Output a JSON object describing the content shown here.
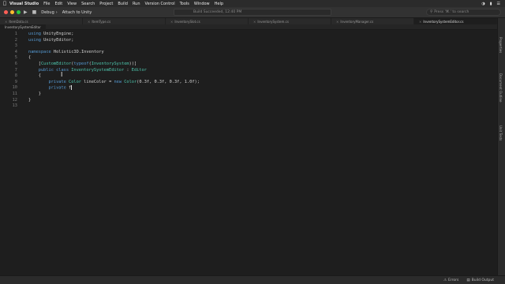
{
  "menubar": {
    "app": "Visual Studio",
    "items": [
      "File",
      "Edit",
      "View",
      "Search",
      "Project",
      "Build",
      "Run",
      "Version Control",
      "Tools",
      "Window",
      "Help"
    ]
  },
  "toolbar": {
    "config": "Debug",
    "target": "Attach to Unity",
    "status": "Build Succeeded, 12:40 PM",
    "search_placeholder": "Press '⌘.' to search"
  },
  "tabs": [
    {
      "label": "ItemData.cs",
      "active": false
    },
    {
      "label": "ItemType.cs",
      "active": false
    },
    {
      "label": "InventorySlot.cs",
      "active": false
    },
    {
      "label": "InventorySystem.cs",
      "active": false
    },
    {
      "label": "InventoryManager.cs",
      "active": false
    },
    {
      "label": "InventorySystemEditor.cs",
      "active": true
    }
  ],
  "subtab": "InventorySystemEditor",
  "line_numbers": [
    "1",
    "2",
    "3",
    "4",
    "5",
    "6",
    "7",
    "8",
    "9",
    "10",
    "11",
    "12",
    "13"
  ],
  "code": {
    "l1_kw": "using",
    "l1_rest": " UnityEngine;",
    "l2_kw": "using",
    "l2_rest": " UnityEditor;",
    "l4_kw": "namespace",
    "l4_rest": " Holistic3D.Inventory",
    "l5": "{",
    "l6_a": "    [",
    "l6_ty": "CustomEditor",
    "l6_b": "(",
    "l6_kw": "typeof",
    "l6_c": "(",
    "l6_ty2": "InventorySystem",
    "l6_d": "))]",
    "l7_kw": "    public class",
    "l7_ty": " InventorySystemEditor",
    "l7_b": " : ",
    "l7_ty2": "Editor",
    "l8": "    {",
    "l9_kw": "        private",
    "l9_ty": " Color",
    "l9_b": " lineColor = ",
    "l9_kw2": "new",
    "l9_ty2": " Color",
    "l9_c": "(0.3f, 0.3f, 0.3f, 1.0f);",
    "l10_kw": "        private",
    "l10_b": " f",
    "l11": "    }",
    "l12": "}"
  },
  "dock": [
    "Properties",
    "Document Outline",
    "Unit Tests"
  ],
  "statusbar": {
    "errors": "Errors",
    "build_output": "Build Output"
  }
}
